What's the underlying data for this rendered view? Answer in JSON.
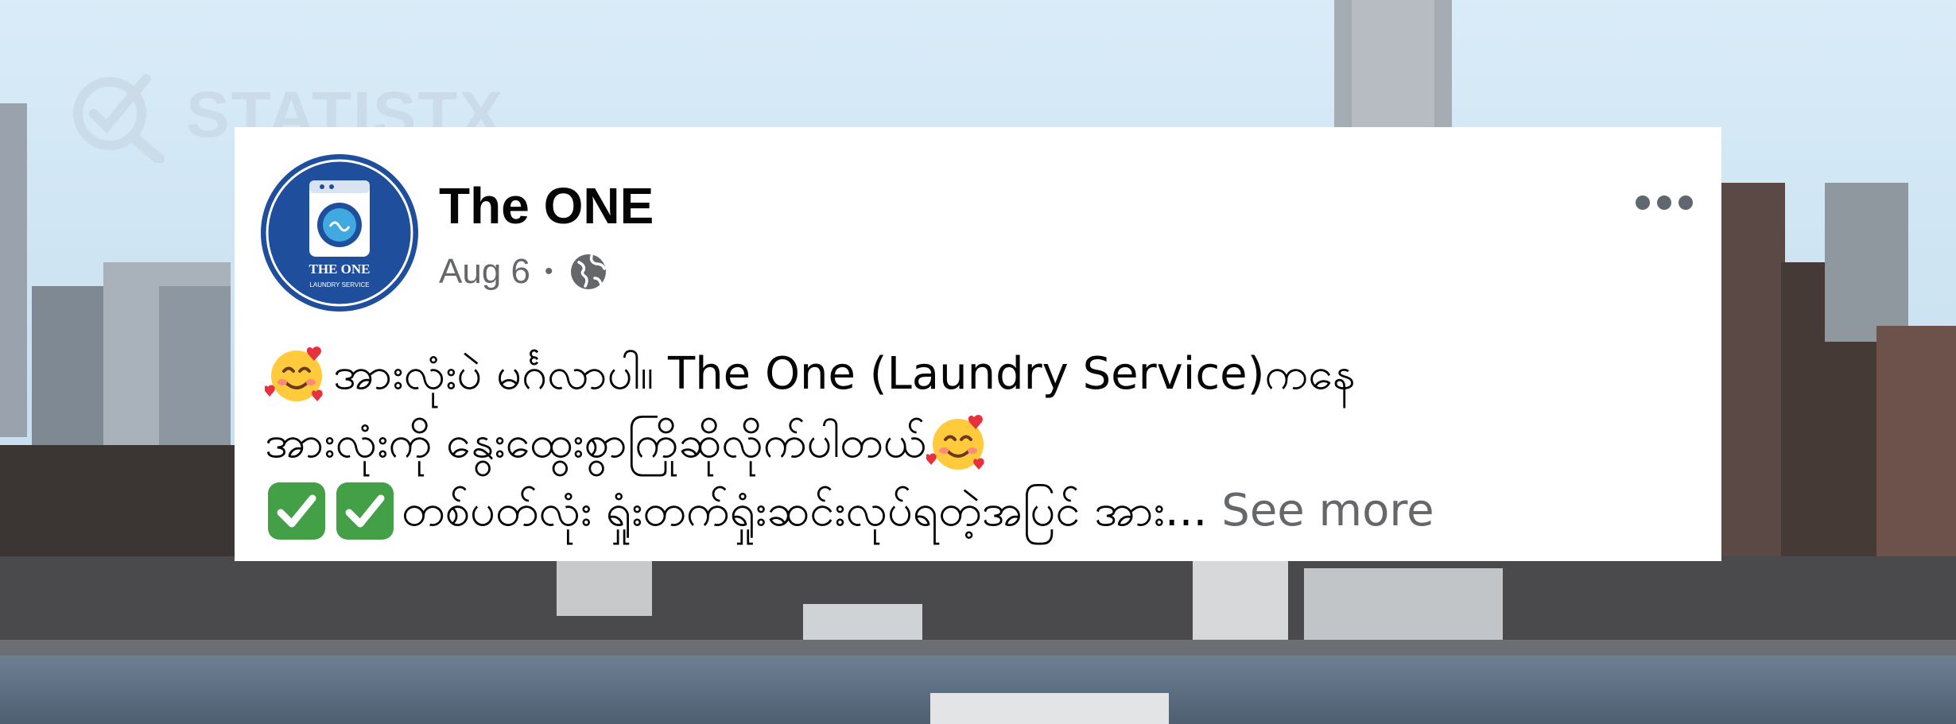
{
  "watermark": {
    "text": "STATISTX"
  },
  "post": {
    "page_name": "The ONE",
    "date": "Aug 6",
    "separator": "•",
    "privacy_icon": "globe-icon",
    "menu_icon": "more-horizontal-icon",
    "avatar": {
      "logo_title": "THE ONE",
      "logo_subtitle": "LAUNDRY SERVICE",
      "brand_color": "#1f4f9c"
    },
    "text_lines": [
      {
        "emoji": [
          "smiling-face-with-hearts-emoji"
        ],
        "text": "အားလုံးပဲ မင်္ဂလာပါ။ The One (Laundry Service)ကနေ"
      },
      {
        "emoji_after": [
          "smiling-face-with-hearts-emoji"
        ],
        "text": "အားလုံးကို နွေးထွေးစွာကြိုဆိုလိုက်ပါတယ်"
      },
      {
        "emoji": [
          "check-mark-button-emoji",
          "check-mark-button-emoji"
        ],
        "text": "တစ်ပတ်လုံး ရှုံးတက်ရှုံးဆင်းလုပ်ရတဲ့အပြင် အား..."
      }
    ],
    "see_more_label": "See more"
  }
}
